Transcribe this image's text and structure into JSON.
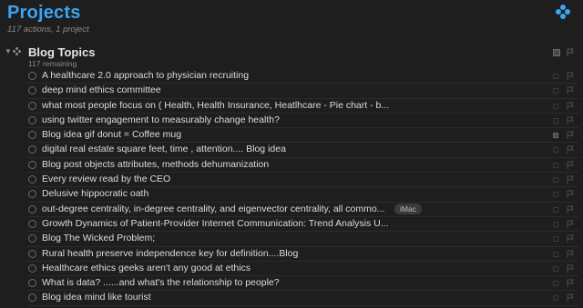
{
  "header": {
    "title": "Projects",
    "subtitle": "117 actions, 1 project"
  },
  "group": {
    "title": "Blog Topics",
    "remaining": "117 remaining"
  },
  "rows": [
    {
      "title": "A healthcare 2.0 approach to physician recruiting",
      "tag": "",
      "note": false
    },
    {
      "title": "deep mind ethics committee",
      "tag": "",
      "note": false
    },
    {
      "title": "what most people focus on ( Health, Health Insurance, Heatlhcare - Pie chart - b...",
      "tag": "",
      "note": false
    },
    {
      "title": "using twitter engagement to measurably change health?",
      "tag": "",
      "note": false
    },
    {
      "title": "Blog idea gif donut = Coffee mug",
      "tag": "",
      "note": true
    },
    {
      "title": "digital real estate square feet, time , attention.... Blog idea",
      "tag": "",
      "note": false
    },
    {
      "title": "Blog post objects attributes, methods dehumanization",
      "tag": "",
      "note": false
    },
    {
      "title": "Every review read by the CEO",
      "tag": "",
      "note": false
    },
    {
      "title": "Delusive hippocratic oath",
      "tag": "",
      "note": false
    },
    {
      "title": "out-degree centrality, in-degree centrality, and eigenvector centrality, all commo...",
      "tag": "iMac",
      "note": false
    },
    {
      "title": "Growth Dynamics of Patient-Provider Internet Communication: Trend Analysis U...",
      "tag": "",
      "note": false
    },
    {
      "title": "Blog The Wicked Problem;",
      "tag": "",
      "note": false
    },
    {
      "title": "Rural health preserve independence key for definition....Blog",
      "tag": "",
      "note": false
    },
    {
      "title": "Healthcare ethics geeks aren't any good at ethics",
      "tag": "",
      "note": false
    },
    {
      "title": "What is data? ......and what's the relationship to people?",
      "tag": "",
      "note": false
    },
    {
      "title": "Blog idea mind like tourist",
      "tag": "",
      "note": false
    }
  ],
  "icons": {
    "perspective": "perspective-dots-icon",
    "group": "project-parallel-icon",
    "flag": "flag-icon",
    "note": "note-icon",
    "status": "status-circle-icon"
  },
  "colors": {
    "accent": "#3aa5f3",
    "background": "#1e1e1e"
  }
}
